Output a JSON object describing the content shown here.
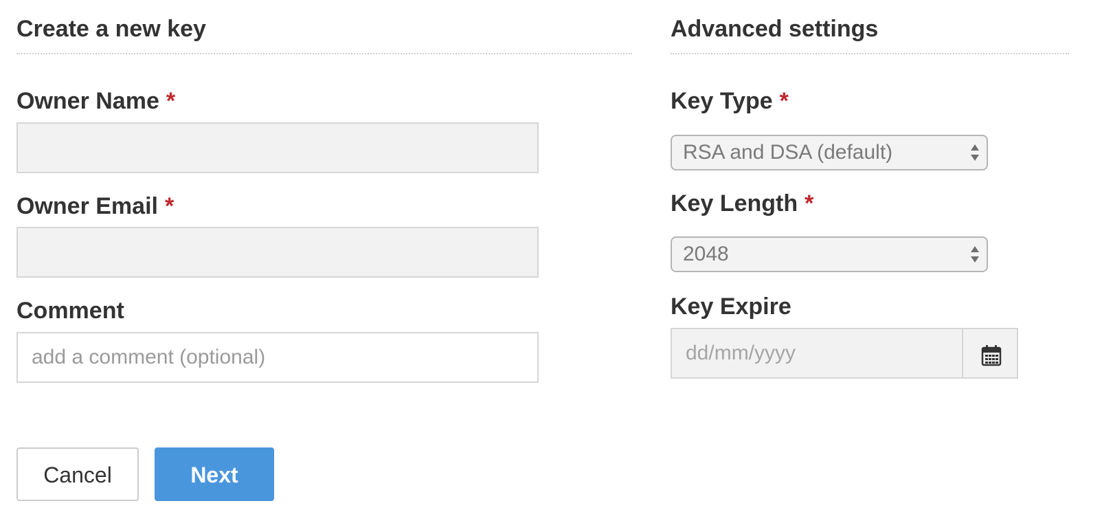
{
  "create_section": {
    "title": "Create a new key",
    "owner_name": {
      "label": "Owner Name",
      "required_mark": "*",
      "value": "",
      "placeholder": ""
    },
    "owner_email": {
      "label": "Owner Email",
      "required_mark": "*",
      "value": "",
      "placeholder": ""
    },
    "comment": {
      "label": "Comment",
      "value": "",
      "placeholder": "add a comment (optional)"
    }
  },
  "advanced_section": {
    "title": "Advanced settings",
    "key_type": {
      "label": "Key Type",
      "required_mark": "*",
      "selected": "RSA and DSA (default)"
    },
    "key_length": {
      "label": "Key Length",
      "required_mark": "*",
      "selected": "2048"
    },
    "key_expire": {
      "label": "Key Expire",
      "value": "",
      "placeholder": "dd/mm/yyyy",
      "button_icon": "calendar-icon"
    }
  },
  "actions": {
    "cancel_label": "Cancel",
    "next_label": "Next"
  },
  "colors": {
    "primary": "#4a96dc",
    "required": "#c0282d",
    "input_background": "#f2f2f2",
    "text": "#333333"
  }
}
